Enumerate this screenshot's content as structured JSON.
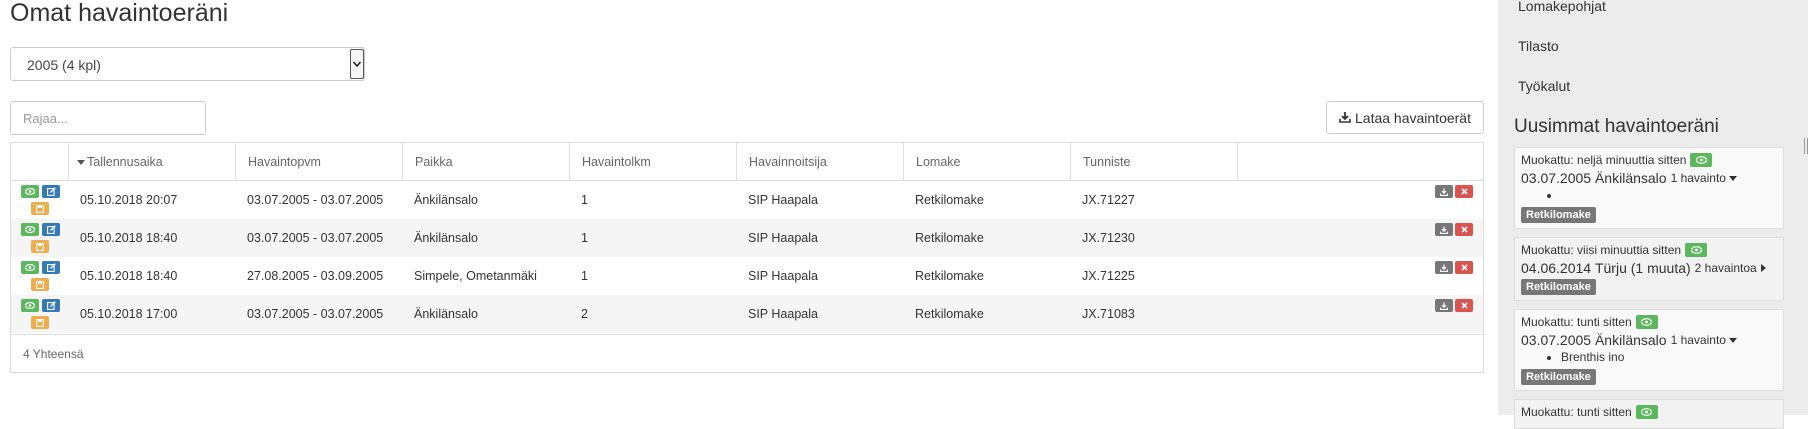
{
  "main": {
    "title": "Omat havaintoeräni",
    "year_select": {
      "value": "2005 (4 kpl)"
    },
    "filter": {
      "placeholder": "Rajaa..."
    },
    "download_button": "Lataa havaintoerät",
    "grid": {
      "columns": [
        "",
        "Tallennusaika",
        "Havaintopvm",
        "Paikka",
        "Havaintolkm",
        "Havainnoitsija",
        "Lomake",
        "Tunniste"
      ],
      "rows": [
        {
          "saved": "05.10.2018 20:07",
          "dates": "03.07.2005 - 03.07.2005",
          "place": "Änkilänsalo",
          "count": "1",
          "observer": "SIP Haapala",
          "form": "Retkilomake",
          "id": "JX.71227"
        },
        {
          "saved": "05.10.2018 18:40",
          "dates": "03.07.2005 - 03.07.2005",
          "place": "Änkilänsalo",
          "count": "1",
          "observer": "SIP Haapala",
          "form": "Retkilomake",
          "id": "JX.71230"
        },
        {
          "saved": "05.10.2018 18:40",
          "dates": "27.08.2005 - 03.09.2005",
          "place": "Simpele, Ometanmäki",
          "count": "1",
          "observer": "SIP Haapala",
          "form": "Retkilomake",
          "id": "JX.71225"
        },
        {
          "saved": "05.10.2018 17:00",
          "dates": "03.07.2005 - 03.07.2005",
          "place": "Änkilänsalo",
          "count": "2",
          "observer": "SIP Haapala",
          "form": "Retkilomake",
          "id": "JX.71083"
        }
      ],
      "footer": "4 Yhteensä"
    }
  },
  "sidebar": {
    "nav": [
      "Lomakepohjat",
      "Tilasto",
      "Työkalut"
    ],
    "title": "Uusimmat havaintoeräni",
    "cards": [
      {
        "modified": "Muokattu: neljä minuuttia sitten",
        "date": "03.07.2005",
        "place": "Änkilänsalo",
        "count": "1 havainto",
        "items": [
          ""
        ],
        "form": "Retkilomake"
      },
      {
        "modified": "Muokattu: viisi minuuttia sitten",
        "date": "04.06.2014",
        "place": "Türju (1 muuta)",
        "count": "2 havaintoa",
        "items": [],
        "form": "Retkilomake"
      },
      {
        "modified": "Muokattu: tunti sitten",
        "date": "03.07.2005",
        "place": "Änkilänsalo",
        "count": "1 havainto",
        "items": [
          "Brenthis ino"
        ],
        "form": "Retkilomake"
      },
      {
        "modified": "Muokattu: tunti sitten"
      }
    ]
  },
  "icons": {
    "view": "eye-icon",
    "edit": "edit-icon",
    "save": "save-icon",
    "download": "download-icon",
    "delete": "close-icon"
  },
  "colors": {
    "green": "#5cb85c",
    "blue": "#337ab7",
    "orange": "#f0ad4e",
    "gray": "#777777",
    "red": "#d9534f",
    "sidebar_bg": "#ececec"
  }
}
